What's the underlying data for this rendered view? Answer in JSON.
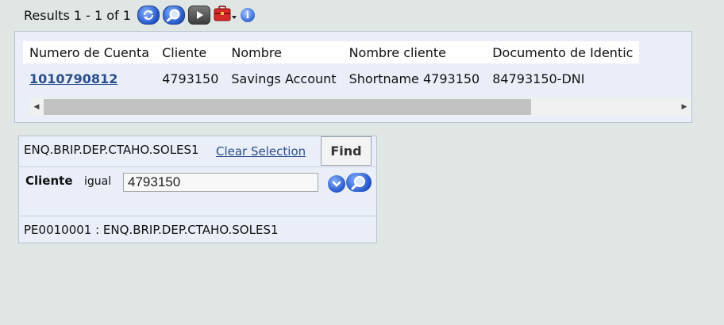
{
  "results_bar": {
    "text": "Results 1 - 1 of 1",
    "icons": [
      "refresh-icon",
      "search-icon",
      "play-icon",
      "toolbox-icon",
      "info-icon"
    ]
  },
  "table": {
    "columns": [
      "Numero de Cuenta",
      "Cliente",
      "Nombre",
      "Nombre cliente",
      "Documento de Identic"
    ],
    "rows": [
      [
        "1010790812",
        "4793150",
        "Savings Account",
        "Shortname 4793150",
        "84793150-DNI"
      ]
    ]
  },
  "selection": {
    "enquiry_name": "ENQ.BRIP.DEP.CTAHO.SOLES1",
    "clear_label": "Clear Selection",
    "find_label": "Find",
    "criteria": {
      "field": "Cliente",
      "operator": "igual",
      "value": "4793150"
    },
    "footer": "PE0010001 : ENQ.BRIP.DEP.CTAHO.SOLES1"
  },
  "colors": {
    "link": "#2b4e8e",
    "panel_bg": "#e9eef8",
    "page_bg": "#dfe6e4"
  }
}
